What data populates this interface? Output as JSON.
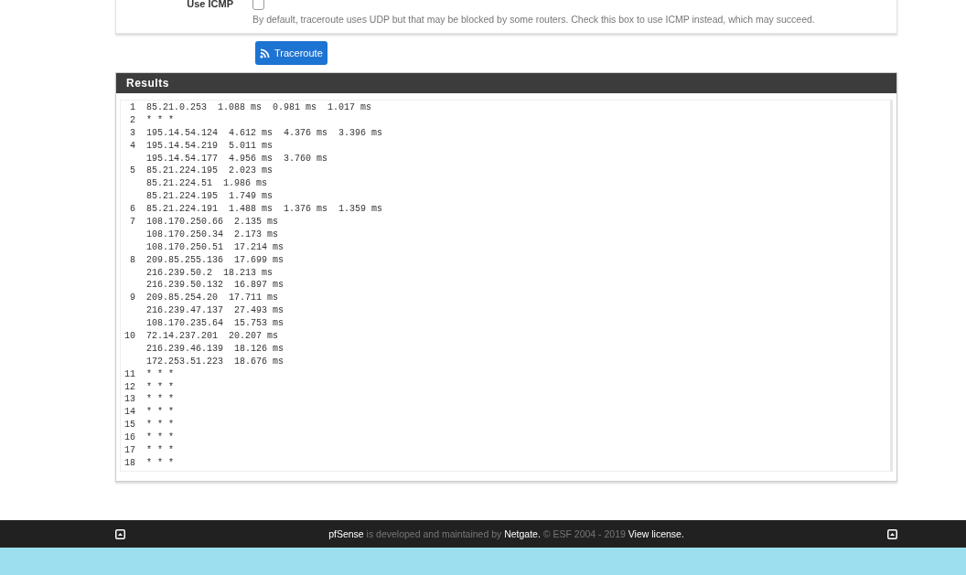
{
  "options": {
    "label": "Use ICMP",
    "checked": false,
    "help": "By default, traceroute uses UDP but that may be blocked by some routers. Check this box to use ICMP instead, which may succeed."
  },
  "button": {
    "label": "Traceroute"
  },
  "results": {
    "title": "Results",
    "lines": [
      " 1  85.21.0.253  1.088 ms  0.981 ms  1.017 ms",
      " 2  * * *",
      " 3  195.14.54.124  4.612 ms  4.376 ms  3.396 ms",
      " 4  195.14.54.219  5.011 ms",
      "    195.14.54.177  4.956 ms  3.760 ms",
      " 5  85.21.224.195  2.023 ms",
      "    85.21.224.51  1.986 ms",
      "    85.21.224.195  1.749 ms",
      " 6  85.21.224.191  1.488 ms  1.376 ms  1.359 ms",
      " 7  108.170.250.66  2.135 ms",
      "    108.170.250.34  2.173 ms",
      "    108.170.250.51  17.214 ms",
      " 8  209.85.255.136  17.699 ms",
      "    216.239.50.2  18.213 ms",
      "    216.239.50.132  16.897 ms",
      " 9  209.85.254.20  17.711 ms",
      "    216.239.47.137  27.493 ms",
      "    108.170.235.64  15.753 ms",
      "10  72.14.237.201  20.207 ms",
      "    216.239.46.139  18.126 ms",
      "    172.253.51.223  18.676 ms",
      "11  * * *",
      "12  * * *",
      "13  * * *",
      "14  * * *",
      "15  * * *",
      "16  * * *",
      "17  * * *",
      "18  * * *"
    ]
  },
  "footer": {
    "parts": [
      {
        "kind": "link",
        "text": "pfSense"
      },
      {
        "kind": "text",
        "text": " is developed and maintained by "
      },
      {
        "kind": "link",
        "text": "Netgate."
      },
      {
        "kind": "text",
        "text": " © ESF 2004 - 2019 "
      },
      {
        "kind": "link",
        "text": "View license."
      }
    ]
  }
}
